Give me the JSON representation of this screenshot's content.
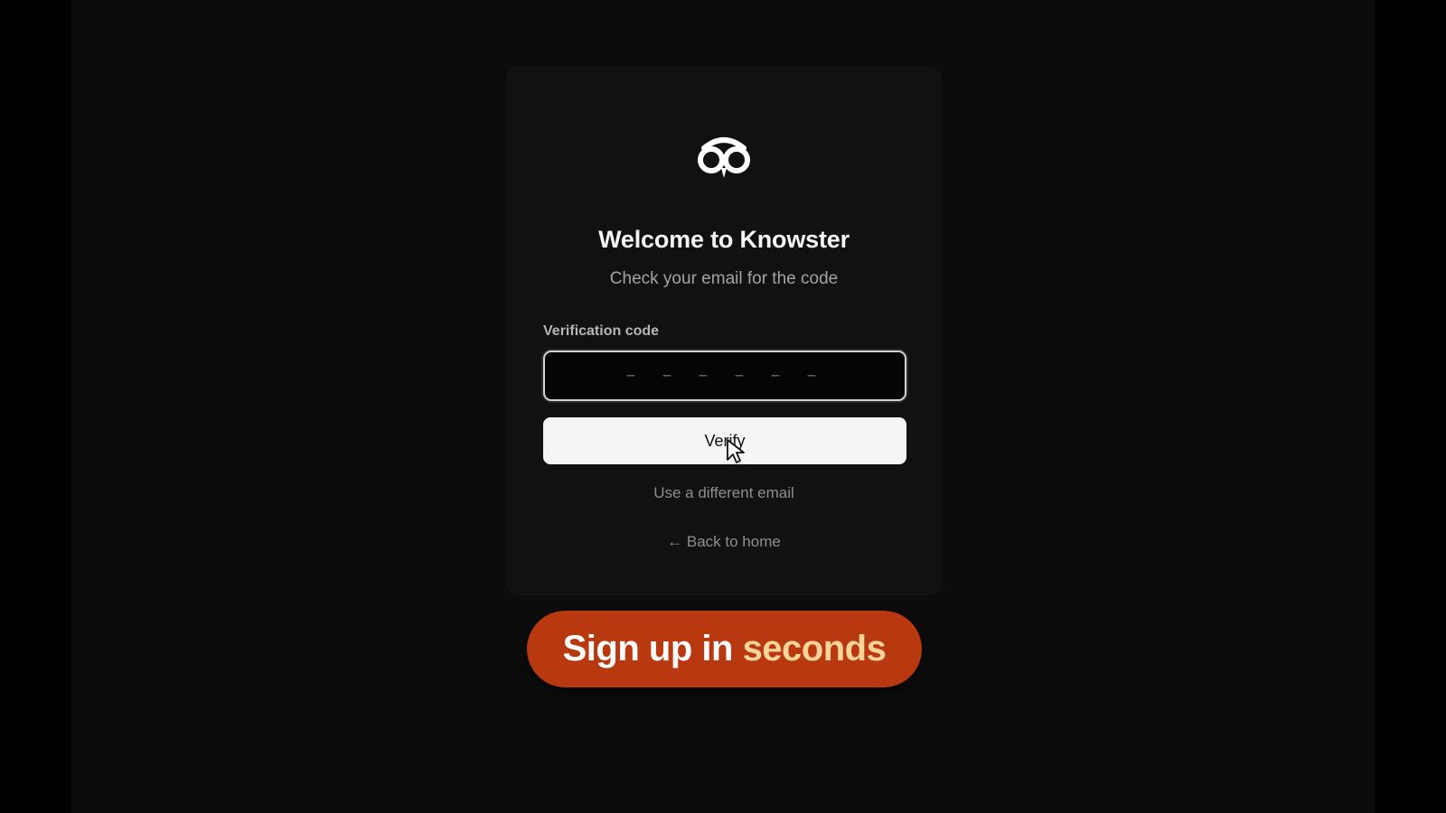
{
  "app": {
    "title": "Welcome to Knowster",
    "subtitle": "Check your email for the code",
    "logo_icon": "owl-logo-icon"
  },
  "form": {
    "label": "Verification code",
    "input_value": "",
    "input_placeholder": "– – – – – –",
    "verify_label": "Verify"
  },
  "links": {
    "different_email": "Use a different email",
    "back_home": "← Back to home"
  },
  "promo": {
    "text_main": "Sign up in ",
    "text_highlight": "seconds"
  },
  "colors": {
    "background": "#0c0c0c",
    "card": "#111111",
    "button": "#f5f5f5",
    "promo_pill": "#b8390f",
    "promo_highlight": "#fcd49a"
  }
}
